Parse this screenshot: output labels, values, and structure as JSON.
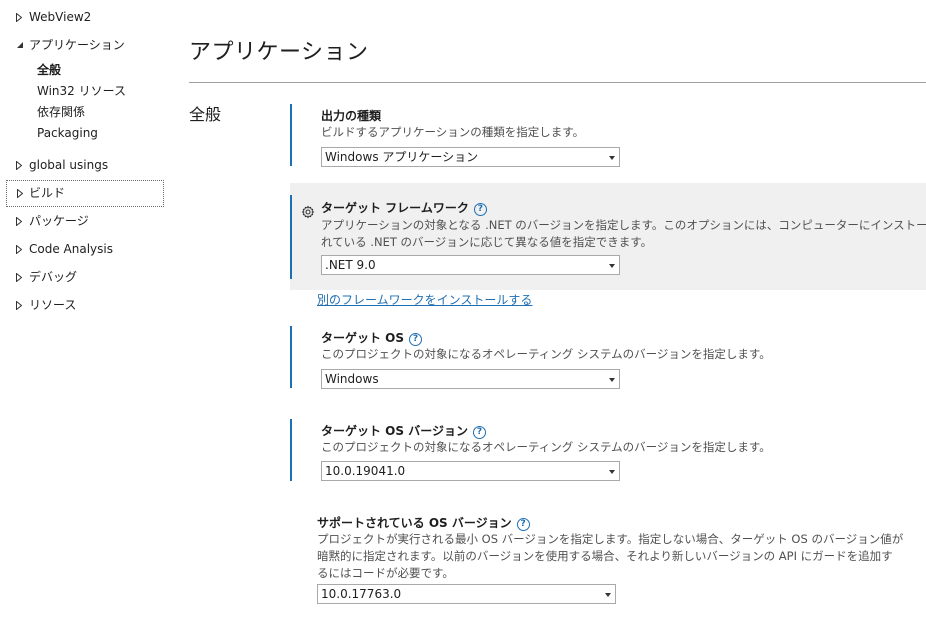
{
  "sidebar": {
    "items": [
      {
        "label": "WebView2",
        "expanded": false
      },
      {
        "label": "アプリケーション",
        "expanded": true,
        "children": [
          "全般",
          "Win32 リソース",
          "依存関係",
          "Packaging"
        ]
      },
      {
        "label": "global usings",
        "expanded": false
      },
      {
        "label": "ビルド",
        "expanded": false
      },
      {
        "label": "パッケージ",
        "expanded": false
      },
      {
        "label": "Code Analysis",
        "expanded": false
      },
      {
        "label": "デバッグ",
        "expanded": false
      },
      {
        "label": "リソース",
        "expanded": false
      }
    ]
  },
  "main": {
    "title": "アプリケーション",
    "section": "全般",
    "properties": [
      {
        "title": "出力の種類",
        "has_help": false,
        "desc": "ビルドするアプリケーションの種類を指定します。",
        "value": "Windows アプリケーション"
      },
      {
        "title": "ターゲット フレームワーク",
        "has_help": true,
        "desc": "アプリケーションの対象となる .NET のバージョンを指定します。このオプションには、コンピューターにインストールされている .NET のバージョンに応じて異なる値を指定できます。",
        "desc_line1": "アプリケーションの対象となる .NET のバージョンを指定します。このオプションには、コンピューターにインストールさ",
        "desc_line2": "れている .NET のバージョンに応じて異なる値を指定できます。",
        "value": ".NET 9.0",
        "link": "別のフレームワークをインストールする"
      },
      {
        "title": "ターゲット OS",
        "has_help": true,
        "desc": "このプロジェクトの対象になるオペレーティング システムのバージョンを指定します。",
        "value": "Windows"
      },
      {
        "title": "ターゲット OS バージョン",
        "has_help": true,
        "desc": "このプロジェクトの対象になるオペレーティング システムのバージョンを指定します。",
        "value": "10.0.19041.0"
      },
      {
        "title": "サポートされている OS バージョン",
        "has_help": true,
        "desc_line1": "プロジェクトが実行される最小 OS バージョンを指定します。指定しない場合、ターゲット OS のバージョン値が",
        "desc_line2": "暗黙的に指定されます。以前のバージョンを使用する場合、それより新しいバージョンの API にガードを追加す",
        "desc_line3": "るにはコードが必要です。",
        "value": "10.0.17763.0"
      }
    ]
  },
  "icons": {
    "help": "?",
    "accent": "#1f6fb2"
  }
}
